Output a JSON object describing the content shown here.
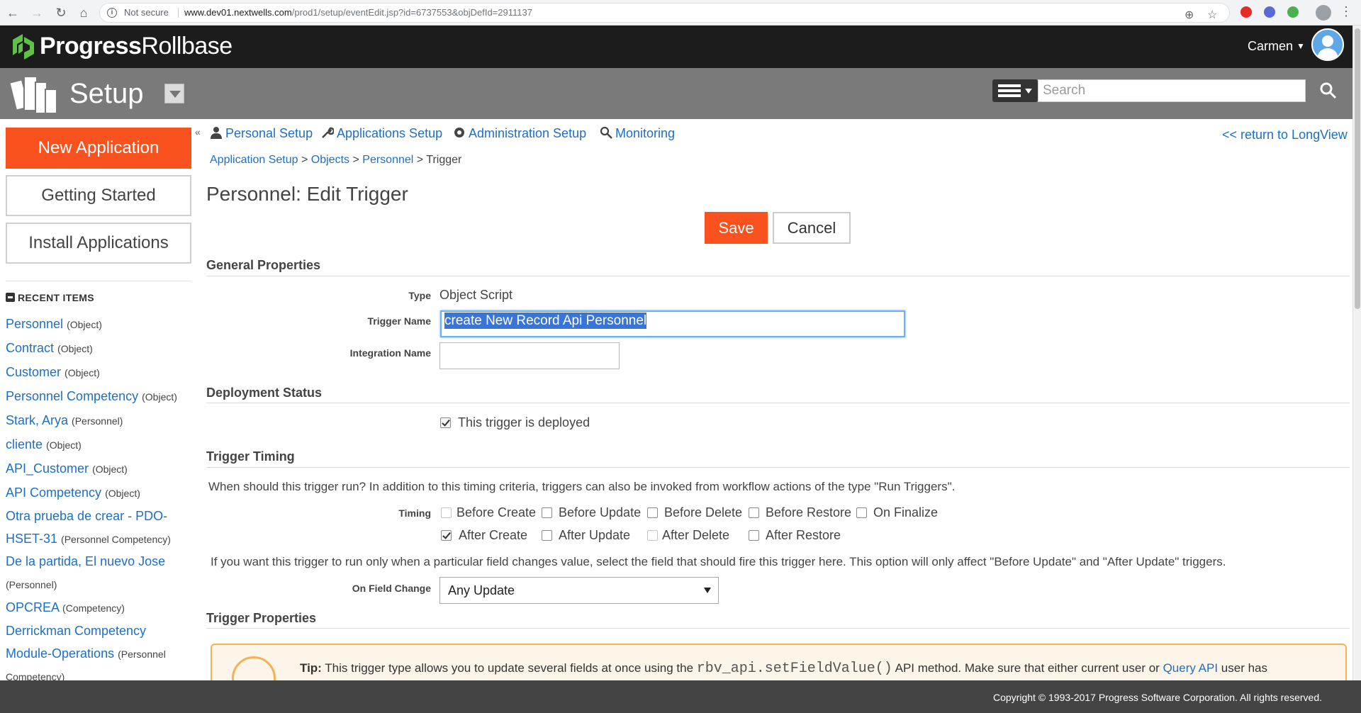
{
  "browser": {
    "not_secure": "Not secure",
    "url_host": "www.dev01.nextwells.com",
    "url_path": "/prod1/setup/eventEdit.jsp?id=6737553&objDefId=2911137"
  },
  "brand": {
    "progress": "Progress",
    "rollbase": "Rollbase",
    "user_name": "Carmen"
  },
  "setup": {
    "title": "Setup",
    "search_placeholder": "Search"
  },
  "sidebar": {
    "new_application": "New Application",
    "getting_started": "Getting Started",
    "install_applications": "Install Applications",
    "recent_items_heading": "RECENT ITEMS",
    "recent_items": [
      {
        "name": "Personnel",
        "type": "(Object)"
      },
      {
        "name": "Contract",
        "type": "(Object)"
      },
      {
        "name": "Customer",
        "type": "(Object)"
      },
      {
        "name": "Personnel Competency",
        "type": "(Object)"
      },
      {
        "name": "Stark, Arya",
        "type": "(Personnel)"
      },
      {
        "name": "cliente",
        "type": "(Object)"
      },
      {
        "name": "API_Customer",
        "type": "(Object)"
      },
      {
        "name": "API Competency",
        "type": "(Object)"
      },
      {
        "name": "Otra prueba de crear - PDO-HSET-31",
        "type": "(Personnel Competency)"
      },
      {
        "name": "De la partida, El nuevo Jose",
        "type": "(Personnel)"
      },
      {
        "name": "OPCREA",
        "type": "(Competency)"
      },
      {
        "name": "Derrickman Competency Module-Operations",
        "type": "(Personnel Competency)"
      }
    ]
  },
  "topnav": {
    "personal_setup": "Personal Setup",
    "applications_setup": "Applications Setup",
    "administration_setup": "Administration Setup",
    "monitoring": "Monitoring",
    "return_link": "<< return to LongView"
  },
  "breadcrumb": {
    "crumb1": "Application Setup",
    "crumb2": "Objects",
    "crumb3": "Personnel",
    "current": "Trigger",
    "separator": ">"
  },
  "page": {
    "title": "Personnel: Edit Trigger",
    "save": "Save",
    "cancel": "Cancel"
  },
  "general": {
    "heading": "General Properties",
    "type_label": "Type",
    "type_value": "Object Script",
    "trigger_name_label": "Trigger Name",
    "trigger_name_value": "create New Record Api Personnel",
    "integration_name_label": "Integration Name",
    "integration_name_value": ""
  },
  "deployment": {
    "heading": "Deployment Status",
    "deployed_label": "This trigger is deployed",
    "deployed": true
  },
  "timing": {
    "heading": "Trigger Timing",
    "intro": "When should this trigger run? In addition to this timing criteria, triggers can also be invoked from workflow actions of the type \"Run Triggers\".",
    "label": "Timing",
    "row1": [
      {
        "label": "Before Create",
        "checked": false
      },
      {
        "label": "Before Update",
        "checked": false
      },
      {
        "label": "Before Delete",
        "checked": false
      },
      {
        "label": "Before Restore",
        "checked": false
      },
      {
        "label": "On Finalize",
        "checked": false
      }
    ],
    "row2": [
      {
        "label": "After Create",
        "checked": true
      },
      {
        "label": "After Update",
        "checked": false
      },
      {
        "label": "After Delete",
        "checked": false
      },
      {
        "label": "After Restore",
        "checked": false
      }
    ],
    "field_change_note": "If you want this trigger to run only when a particular field changes value, select the field that should fire this trigger here. This option will only affect \"Before Update\" and \"After Update\" triggers.",
    "on_field_change_label": "On Field Change",
    "on_field_change_value": "Any Update"
  },
  "properties": {
    "heading": "Trigger Properties",
    "tip_label": "Tip:",
    "tip_text_1": "This trigger type allows you to update several fields at once using the",
    "tip_code": "rbv_api.setFieldValue()",
    "tip_text_2": "API method. Make sure that either current user or",
    "tip_link": "Query API",
    "tip_text_3": "user has"
  },
  "footer": {
    "copyright": "Copyright © 1993-2017 Progress Software Corporation. All rights reserved."
  },
  "colors": {
    "accent_orange": "#f9521e",
    "link_blue": "#1e6fc4",
    "header_dark": "#1c1c1c",
    "setup_gray": "#7a7a7a",
    "logo_green": "#5fc148"
  }
}
